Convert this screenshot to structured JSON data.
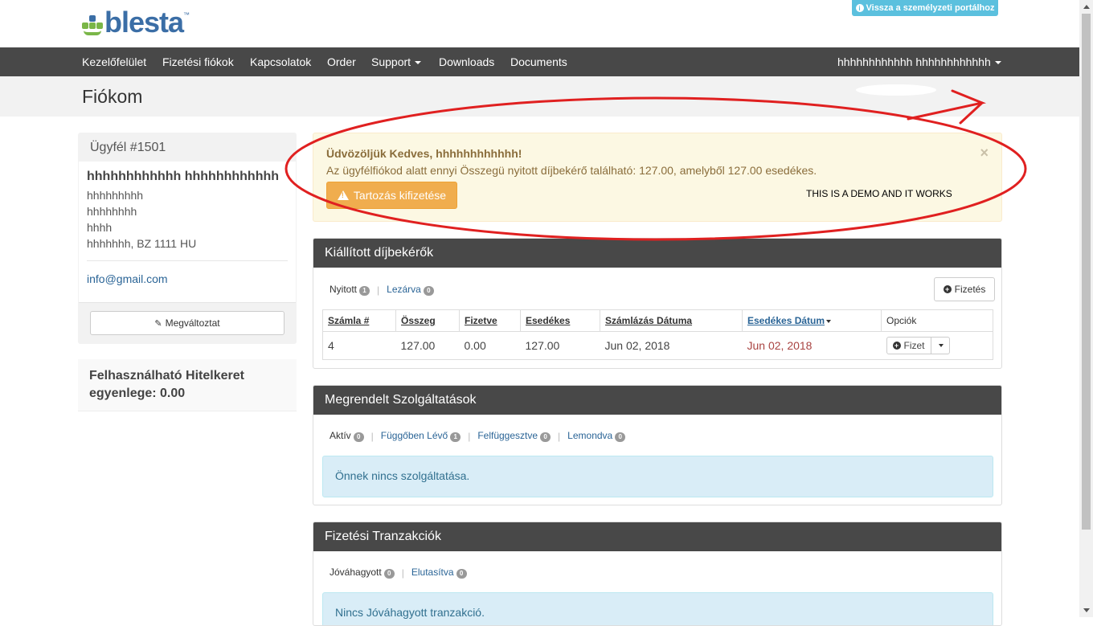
{
  "header": {
    "logo_text": "blesta",
    "logo_tm": "™",
    "portal_button": "Vissza a személyzeti portálhoz"
  },
  "nav": {
    "items": [
      "Kezelőfelület",
      "Fizetési fiókok",
      "Kapcsolatok",
      "Order",
      "Support",
      "Downloads",
      "Documents"
    ],
    "user": "hhhhhhhhhhhh hhhhhhhhhhhh"
  },
  "page_title": "Fiókom",
  "client": {
    "header": "Ügyfél #1501",
    "name": "hhhhhhhhhhhh hhhhhhhhhhhh",
    "address_lines": [
      "hhhhhhhhh",
      "hhhhhhhh",
      "hhhh",
      "hhhhhhh, BZ 1111 HU"
    ],
    "email": "info@gmail.com",
    "edit_button": "Megváltoztat"
  },
  "credit": {
    "text": "Felhasználható Hitelkeret egyenlege: 0.00"
  },
  "alert": {
    "title": "Üdvözöljük Kedves, hhhhhhhhhhhh!",
    "text": "Az ügyfélfiókod alatt ennyi Összegü nyitott díjbekérő található: 127.00, amelyből 127.00 esedékes.",
    "button": "Tartozás kifizetése",
    "close": "×",
    "demo_note": "THIS IS A DEMO AND IT WORKS"
  },
  "invoices": {
    "title": "Kiállított díjbekérők",
    "filters": [
      {
        "label": "Nyitott",
        "count": "1"
      },
      {
        "label": "Lezárva",
        "count": "0"
      }
    ],
    "pay_button": "Fizetés",
    "columns": [
      "Számla #",
      "Összeg",
      "Fizetve",
      "Esedékes",
      "Számlázás Dátuma",
      "Esedékes Dátum",
      "Opciók"
    ],
    "rows": [
      {
        "number": "4",
        "amount": "127.00",
        "paid": "0.00",
        "due": "127.00",
        "billed": "Jun 02, 2018",
        "due_date": "Jun 02, 2018",
        "action": "Fizet"
      }
    ]
  },
  "services": {
    "title": "Megrendelt Szolgáltatások",
    "filters": [
      {
        "label": "Aktív",
        "count": "0"
      },
      {
        "label": "Függőben Lévő",
        "count": "1"
      },
      {
        "label": "Felfüggesztve",
        "count": "0"
      },
      {
        "label": "Lemondva",
        "count": "0"
      }
    ],
    "empty": "Önnek nincs szolgáltatása."
  },
  "transactions": {
    "title": "Fizetési Tranzakciók",
    "filters": [
      {
        "label": "Jóváhagyott",
        "count": "0"
      },
      {
        "label": "Elutasítva",
        "count": "0"
      }
    ],
    "empty": "Nincs Jóváhagyott tranzakció."
  },
  "colors": {
    "navbar": "#484848",
    "alert_bg": "#fcf8e3",
    "warning_button": "#f0ad4e",
    "info_bg": "#d9edf7",
    "annotation_red": "#e02020"
  }
}
